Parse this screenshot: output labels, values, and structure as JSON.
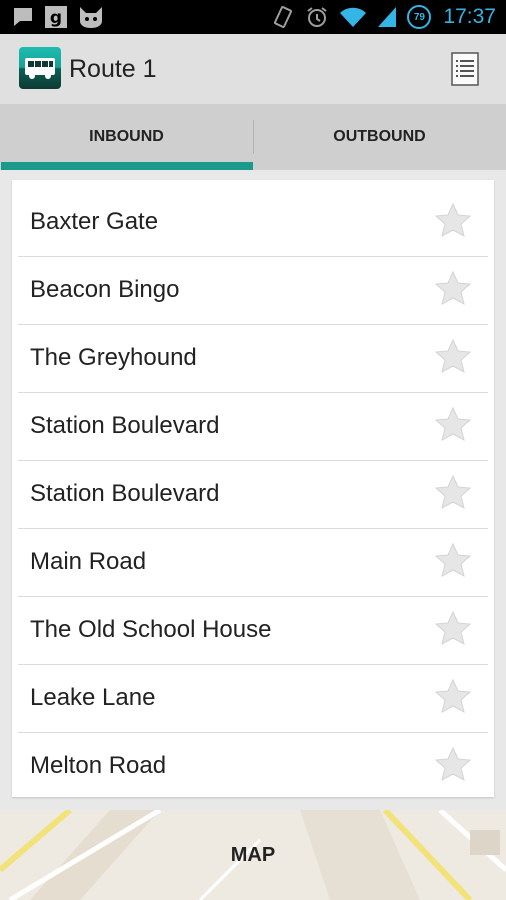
{
  "status_bar": {
    "time": "17:37",
    "battery_level": "79",
    "icons": [
      "chat-icon",
      "g-icon",
      "cat-icon",
      "vibrate-icon",
      "alarm-icon",
      "wifi-icon",
      "signal-icon",
      "battery-icon"
    ]
  },
  "action_bar": {
    "title": "Route 1",
    "app_icon": "bus-icon",
    "menu_icon": "list-icon"
  },
  "tabs": [
    {
      "label": "INBOUND",
      "selected": true
    },
    {
      "label": "OUTBOUND",
      "selected": false
    }
  ],
  "stops": [
    {
      "name": "Baxter Gate",
      "favorite": false
    },
    {
      "name": "Beacon Bingo",
      "favorite": false
    },
    {
      "name": "The Greyhound",
      "favorite": false
    },
    {
      "name": "Station Boulevard",
      "favorite": false
    },
    {
      "name": "Station Boulevard",
      "favorite": false
    },
    {
      "name": "Main Road",
      "favorite": false
    },
    {
      "name": "The Old School House",
      "favorite": false
    },
    {
      "name": "Leake Lane",
      "favorite": false
    },
    {
      "name": "Melton Road",
      "favorite": false
    }
  ],
  "map": {
    "label": "MAP"
  },
  "colors": {
    "accent": "#1a9a8a",
    "status_blue": "#33b5e5",
    "star": "#e6e6e6"
  }
}
